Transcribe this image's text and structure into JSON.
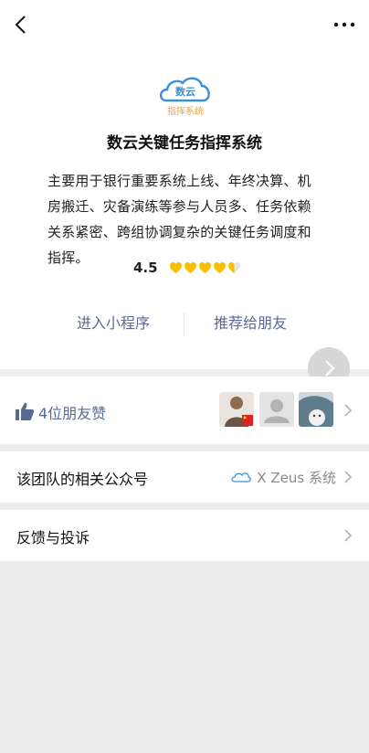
{
  "nav": {
    "back_icon": "chevron-left-icon",
    "more_icon": "more-dots-icon"
  },
  "app": {
    "logo_text": "数云",
    "logo_subtext": "指挥系统",
    "title": "数云关键任务指挥系统",
    "description": "主要用于银行重要系统上线、年终决算、机房搬迁、灾备演练等参与人员多、任务依赖关系紧密、跨组协调复杂的关键任务调度和指挥。",
    "rating": "4.5",
    "rating_value": 4.5,
    "rating_max": 5
  },
  "actions": {
    "open_label": "进入小程序",
    "share_label": "推荐给朋友"
  },
  "likes": {
    "text": "4位朋友赞"
  },
  "public_account": {
    "label": "该团队的相关公众号",
    "value": "X Zeus 系统"
  },
  "feedback": {
    "label": "反馈与投诉"
  },
  "colors": {
    "link": "#576b95",
    "star": "#f7c100",
    "brand_blue": "#3a8fd9",
    "brand_orange": "#f0a13a"
  }
}
